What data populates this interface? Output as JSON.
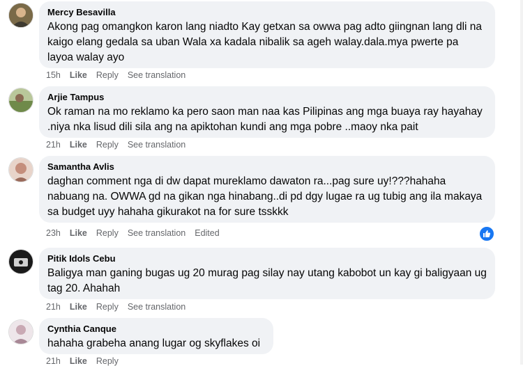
{
  "comments": [
    {
      "author": "Mercy Besavilla",
      "text": "Akong pag omangkon karon lang niadto Kay getxan sa owwa pag adto giingnan lang dli na kaigo elang gedala sa uban Wala xa kadala nibalik sa ageh walay.dala.mya pwerte pa layoa walay ayo",
      "time": "15h",
      "like": "Like",
      "reply": "Reply",
      "translate": "See translation",
      "avatar_color": "#6b5a3c"
    },
    {
      "author": "Arjie Tampus",
      "text": "Ok raman na mo reklamo ka pero saon man naa kas Pilipinas ang mga buaya ray hayahay .niya nka lisud dili sila ang na apiktohan kundi ang mga pobre ..maoy nka pait",
      "time": "21h",
      "like": "Like",
      "reply": "Reply",
      "translate": "See translation",
      "avatar_color": "#8aa06a"
    },
    {
      "author": "Samantha Avlis",
      "text": "daghan comment nga di dw dapat mureklamo dawaton ra...pag sure uy!???hahaha nabuang na. OWWA gd na gikan nga hinabang..di pd dgy lugae ra ug tubig ang ila makaya sa budget uyy hahaha gikurakot na for sure tsskkk",
      "time": "23h",
      "like": "Like",
      "reply": "Reply",
      "translate": "See translation",
      "edited": "Edited",
      "avatar_color": "#c89a86"
    },
    {
      "author": "Pitik Idols Cebu",
      "text": "Baligya man ganing bugas ug 20 murag pag silay nay utang kabobot un kay gi baligyaan ug tag 20. Ahahah",
      "time": "21h",
      "like": "Like",
      "reply": "Reply",
      "translate": "See translation",
      "avatar_color": "#222222"
    },
    {
      "author": "Cynthia Canque",
      "text": "hahaha grabeha anang lugar og skyflakes oi",
      "time": "21h",
      "like": "Like",
      "reply": "Reply",
      "avatar_color": "#b8a0a8"
    }
  ],
  "reaction": {
    "icon": "like-icon",
    "color": "#1877f2"
  }
}
